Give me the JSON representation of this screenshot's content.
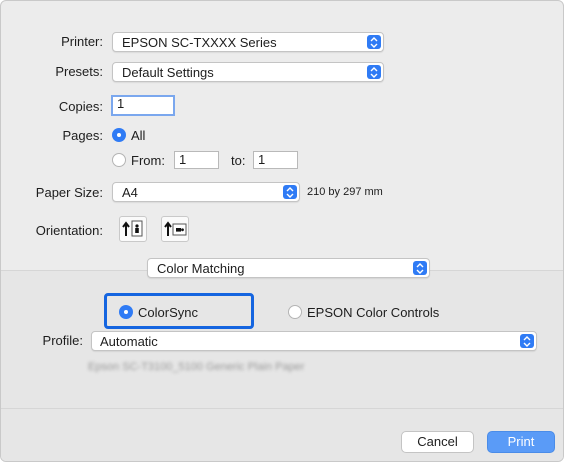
{
  "printer": {
    "label": "Printer:",
    "value": "EPSON SC-TXXXX Series"
  },
  "presets": {
    "label": "Presets:",
    "value": "Default Settings"
  },
  "copies": {
    "label": "Copies:",
    "value": "1"
  },
  "pages": {
    "label": "Pages:",
    "all_label": "All",
    "from_label": "From:",
    "from_value": "1",
    "to_label": "to:",
    "to_value": "1"
  },
  "paper_size": {
    "label": "Paper Size:",
    "value": "A4",
    "dimensions": "210 by 297 mm"
  },
  "orientation": {
    "label": "Orientation:"
  },
  "section": {
    "value": "Color Matching"
  },
  "color_options": {
    "colorsync": "ColorSync",
    "epson": "EPSON Color Controls"
  },
  "profile": {
    "label": "Profile:",
    "value": "Automatic",
    "description": "Epson SC-T3100_5100 Generic Plain Paper"
  },
  "buttons": {
    "cancel": "Cancel",
    "print": "Print"
  },
  "colors": {
    "accent": "#2f7bf5",
    "highlight": "#1565e0"
  }
}
